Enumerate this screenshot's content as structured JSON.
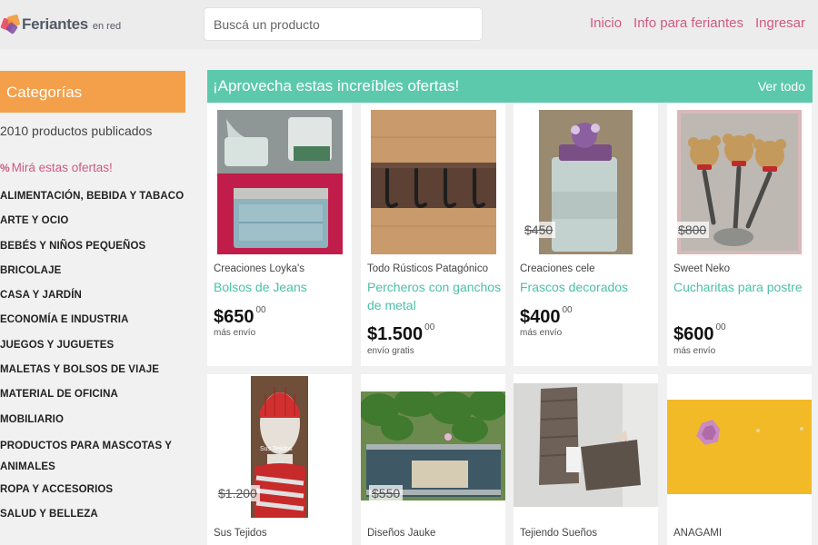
{
  "header": {
    "logo_name": "Feriantes",
    "logo_sub": "en red",
    "search_placeholder": "Buscá un producto",
    "nav": [
      "Inicio",
      "Info para feriantes",
      "Ingresar"
    ]
  },
  "sidebar": {
    "title": "Categorías",
    "count": "2010 productos publicados",
    "offers_icon": "%",
    "offers": "Mirá estas ofertas!",
    "categories": [
      "ALIMENTACIÓN, BEBIDA Y TABACO",
      "ARTE Y OCIO",
      "BEBÉS Y NIÑOS PEQUEÑOS",
      "BRICOLAJE",
      "CASA Y JARDÍN",
      "ECONOMÍA E INDUSTRIA",
      "JUEGOS Y JUGUETES",
      "MALETAS Y BOLSOS DE VIAJE",
      "MATERIAL DE OFICINA",
      "MOBILIARIO",
      "PRODUCTOS PARA MASCOTAS Y ANIMALES",
      "ROPA Y ACCESORIOS",
      "SALUD Y BELLEZA"
    ]
  },
  "banner": {
    "title": "¡Aprovecha estas increíbles ofertas!",
    "view_all": "Ver todo"
  },
  "products": [
    {
      "seller": "Creaciones Loyka's",
      "name": "Bolsos de Jeans",
      "price": "$650",
      "cents": "00",
      "shipping": "más envío",
      "old_price": ""
    },
    {
      "seller": "Todo Rústicos Patagónico",
      "name": "Percheros con ganchos de metal",
      "price": "$1.500",
      "cents": "00",
      "shipping": "envío gratis",
      "old_price": ""
    },
    {
      "seller": "Creaciones cele",
      "name": "Frascos decorados",
      "price": "$400",
      "cents": "00",
      "shipping": "más envío",
      "old_price": "$450"
    },
    {
      "seller": "Sweet Neko",
      "name": "Cucharitas para postre",
      "price": "$600",
      "cents": "00",
      "shipping": "más envío",
      "old_price": "$800"
    },
    {
      "seller": "Sus Tejidos",
      "name": "",
      "price": "",
      "cents": "",
      "shipping": "",
      "old_price": "$1.200",
      "image_text": "Sus Tejidos"
    },
    {
      "seller": "Diseños Jauke",
      "name": "",
      "price": "",
      "cents": "",
      "shipping": "",
      "old_price": "$550"
    },
    {
      "seller": "Tejiendo Sueños",
      "name": "",
      "price": "",
      "cents": "",
      "shipping": "",
      "old_price": ""
    },
    {
      "seller": "ANAGAMI",
      "name": "",
      "price": "",
      "cents": "",
      "shipping": "",
      "old_price": ""
    }
  ],
  "colors": {
    "accent_pink": "#d05a7e",
    "category_orange": "#f4a04a",
    "banner_teal": "#5cc9ad",
    "product_name": "#4cc0a8"
  },
  "icons": [
    "logo-icon",
    "percent-icon"
  ]
}
